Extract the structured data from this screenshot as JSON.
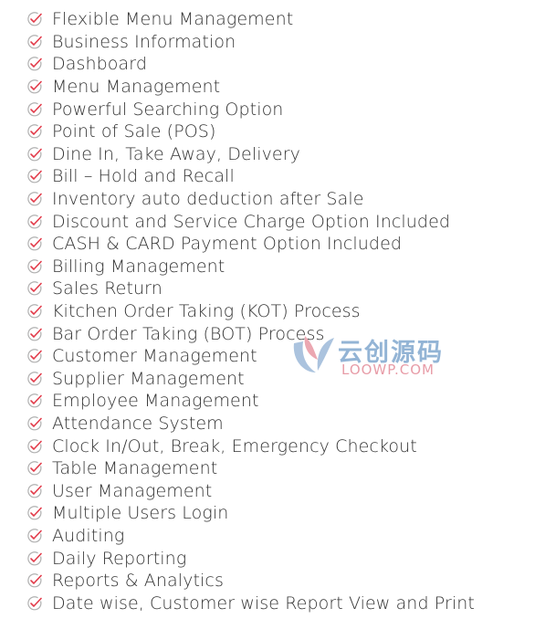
{
  "colors": {
    "check": "#e23b4a",
    "circle": "#b0b0b0",
    "text": "#333333"
  },
  "icon": "check-circle-icon",
  "features": [
    "Flexible Menu Management",
    "Business Information",
    "Dashboard",
    "Menu Management",
    "Powerful Searching Option",
    "Point of Sale (POS)",
    "Dine In, Take Away, Delivery",
    "Bill – Hold and Recall",
    "Inventory auto deduction after Sale",
    "Discount and Service Charge Option Included",
    "CASH & CARD Payment Option Included",
    "Billing Management",
    "Sales Return",
    "Kitchen Order Taking (KOT) Process",
    "Bar Order Taking (BOT) Process",
    "Customer Management",
    "Supplier Management",
    "Employee Management",
    "Attendance System",
    "Clock In/Out, Break, Emergency Checkout",
    "Table Management",
    "User Management",
    "Multiple Users Login",
    "Auditing",
    "Daily Reporting",
    "Reports & Analytics",
    "Date wise, Customer wise Report View and Print"
  ],
  "watermark": {
    "chinese": "云创源码",
    "latin": "LOOWP.COM"
  }
}
